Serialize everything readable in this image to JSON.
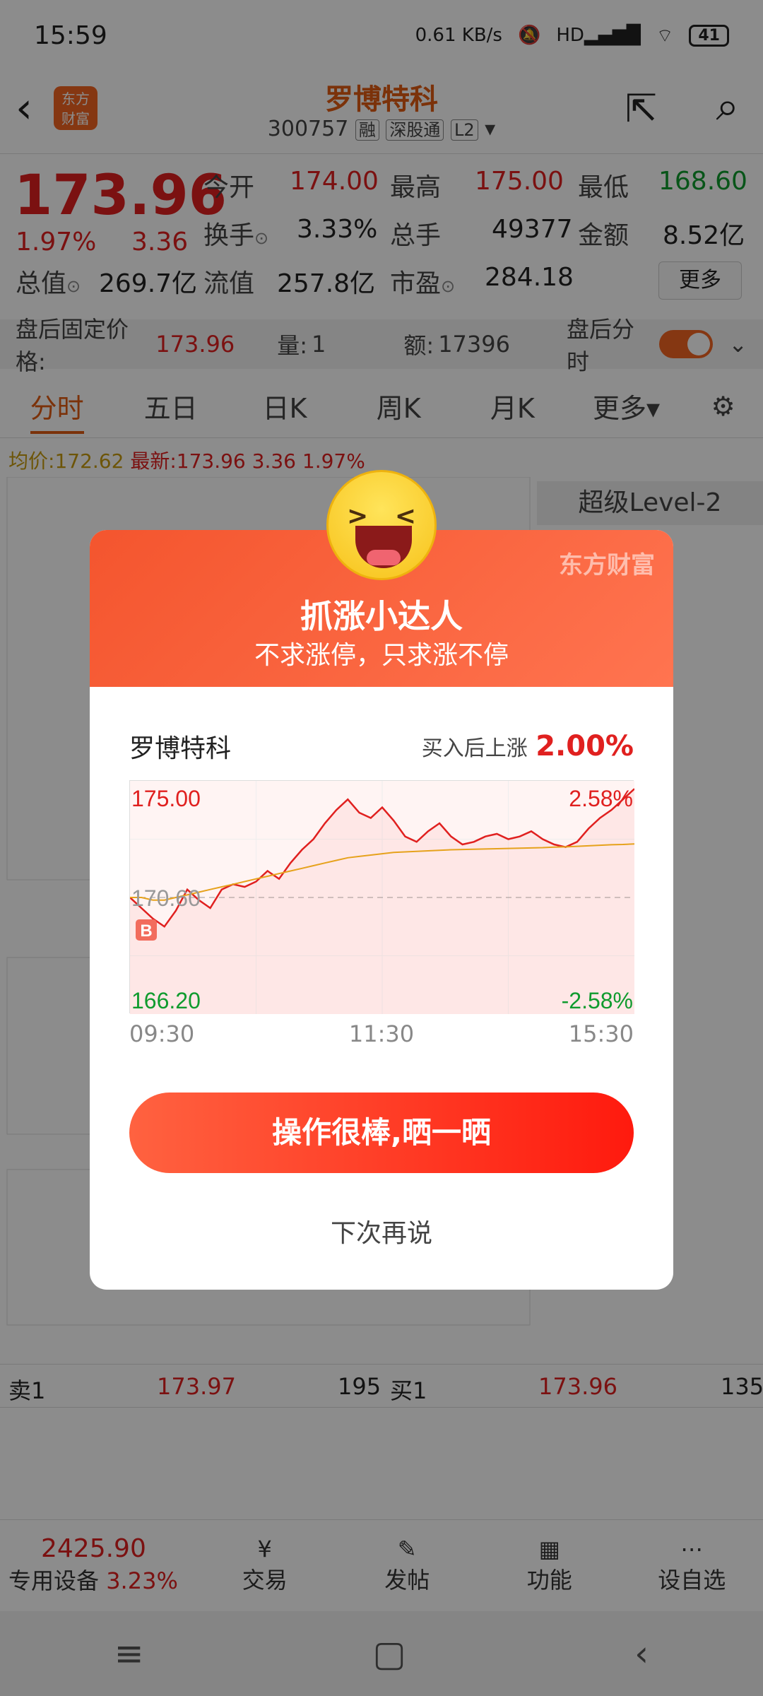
{
  "status": {
    "time": "15:59",
    "net": "0.61 KB/s",
    "signal": "HD",
    "battery": "41"
  },
  "header": {
    "logo_line1": "东方",
    "logo_line2": "财富",
    "name": "罗博特科",
    "code": "300757",
    "tags": [
      "融",
      "深股通",
      "L2"
    ]
  },
  "quote": {
    "price": "173.96",
    "pct": "1.97%",
    "chg": "3.36",
    "row1": [
      {
        "label": "今开",
        "value": "174.00",
        "color": "r"
      },
      {
        "label": "最高",
        "value": "175.00",
        "color": "r"
      },
      {
        "label": "最低",
        "value": "168.60",
        "color": "g"
      }
    ],
    "row2": [
      {
        "label": "换手",
        "value": "3.33%"
      },
      {
        "label": "总手",
        "value": "49377"
      },
      {
        "label": "金额",
        "value": "8.52亿"
      }
    ],
    "row3": [
      {
        "label": "总值",
        "value": "269.7亿"
      },
      {
        "label": "流值",
        "value": "257.8亿"
      },
      {
        "label": "市盈",
        "value": "284.18"
      }
    ],
    "more": "更多"
  },
  "afterhours": {
    "label": "盘后固定价格:",
    "price": "173.96",
    "vol_label": "量:",
    "vol": "1",
    "amt_label": "额:",
    "amt": "17396",
    "toggle_label": "盘后分时"
  },
  "tabs": [
    "分时",
    "五日",
    "日K",
    "周K",
    "月K",
    "更多"
  ],
  "chart_legend": {
    "avg_label": "均价:",
    "avg": "172.62",
    "latest_label": "最新:",
    "latest": "173.96",
    "chg": "3.36",
    "pct": "1.97%"
  },
  "side_panel": {
    "title": "超级Level-2"
  },
  "order_book": {
    "sell_label": "卖1",
    "sell_price": "173.97",
    "sell_vol": "195",
    "buy_label": "买1",
    "buy_price": "173.96",
    "buy_vol": "135"
  },
  "bottom_bar": {
    "index": "2425.90",
    "index_pct": "3.23%",
    "device_label": "专用设备",
    "items": [
      "交易",
      "发帖",
      "功能",
      "设自选"
    ]
  },
  "modal": {
    "brand": "东方财富",
    "title": "抓涨小达人",
    "subtitle": "不求涨停，只求涨不停",
    "stock": "罗博特科",
    "gain_label": "买入后上涨",
    "gain": "2.00%",
    "share_button": "操作很棒,晒一晒",
    "later_button": "下次再说"
  },
  "chart_data": {
    "type": "line",
    "title": "",
    "x_ticks": [
      "09:30",
      "11:30",
      "15:30"
    ],
    "ylim": [
      166.2,
      175.0
    ],
    "y_labels": {
      "top": "175.00",
      "mid": "170.60",
      "bottom": "166.20",
      "top_pct": "2.58%",
      "bottom_pct": "-2.58%"
    },
    "series": [
      {
        "values": [
          170.6,
          170.2,
          169.8,
          169.5,
          170.1,
          170.9,
          170.5,
          170.2,
          170.9,
          171.1,
          171.0,
          171.2,
          171.6,
          171.3,
          171.9,
          172.4,
          172.8,
          173.4,
          173.9,
          174.3,
          173.8,
          173.6,
          174.0,
          173.5,
          172.9,
          172.7,
          173.1,
          173.4,
          172.9,
          172.6,
          172.7,
          172.9,
          173.0,
          172.8,
          172.9,
          173.1,
          172.8,
          172.6,
          172.5,
          172.7,
          173.2,
          173.6,
          173.9,
          174.3,
          174.7
        ]
      },
      {
        "values": [
          170.6,
          170.6,
          170.5,
          170.5,
          170.6,
          170.7,
          170.8,
          170.9,
          171.0,
          171.1,
          171.2,
          171.3,
          171.4,
          171.5,
          171.6,
          171.7,
          171.8,
          171.9,
          172.0,
          172.1,
          172.15,
          172.2,
          172.25,
          172.3,
          172.32,
          172.34,
          172.36,
          172.38,
          172.4,
          172.41,
          172.42,
          172.43,
          172.44,
          172.45,
          172.46,
          172.47,
          172.48,
          172.5,
          172.51,
          172.53,
          172.55,
          172.57,
          172.59,
          172.6,
          172.62
        ]
      }
    ],
    "marker": "B"
  }
}
